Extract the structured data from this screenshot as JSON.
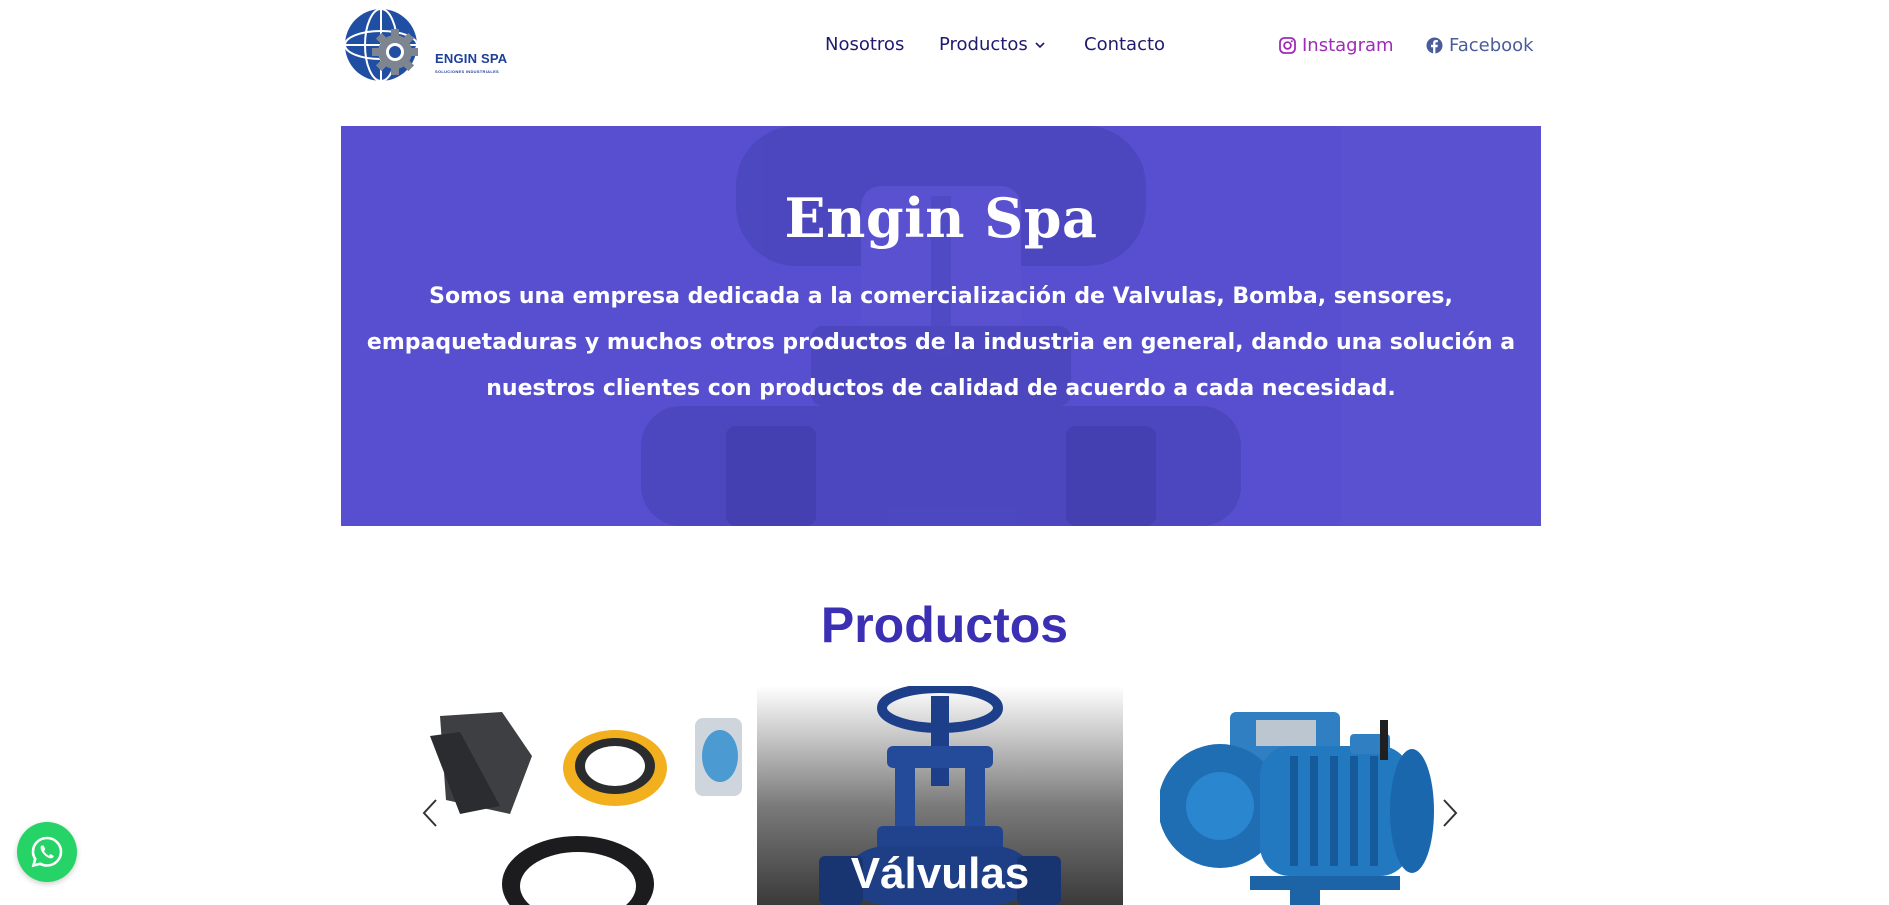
{
  "brand": {
    "name": "ENGIN SPA",
    "tagline": "SOLUCIONES INDUSTRIALES",
    "logo_icon": "globe-gear-icon"
  },
  "nav": {
    "items": [
      {
        "label": "Nosotros"
      },
      {
        "label": "Productos",
        "icon": "chevron-down-icon"
      },
      {
        "label": "Contacto"
      }
    ]
  },
  "social": {
    "instagram": {
      "label": "Instagram",
      "icon": "instagram-icon",
      "color": "#a02bb8"
    },
    "facebook": {
      "label": "Facebook",
      "icon": "facebook-icon",
      "color": "#4a5d9a"
    }
  },
  "hero": {
    "title": "Engin Spa",
    "description": "Somos una empresa dedicada a la comercialización de Valvulas, Bomba, sensores, empaquetaduras y muchos otros productos de la industria en general, dando una solución a nuestros clientes con productos de calidad de acuerdo a cada necesidad.",
    "overlay_color": "#574fd0"
  },
  "products": {
    "title": "Productos",
    "title_color": "#3b2fb4",
    "cards": [
      {
        "label": "",
        "image": "gaskets-image"
      },
      {
        "label": "Válvulas",
        "image": "valve-image"
      },
      {
        "label": "",
        "image": "pump-image"
      }
    ],
    "prev_icon": "chevron-left-icon",
    "next_icon": "chevron-right-icon"
  },
  "whatsapp": {
    "icon": "whatsapp-icon",
    "color": "#25d366"
  }
}
